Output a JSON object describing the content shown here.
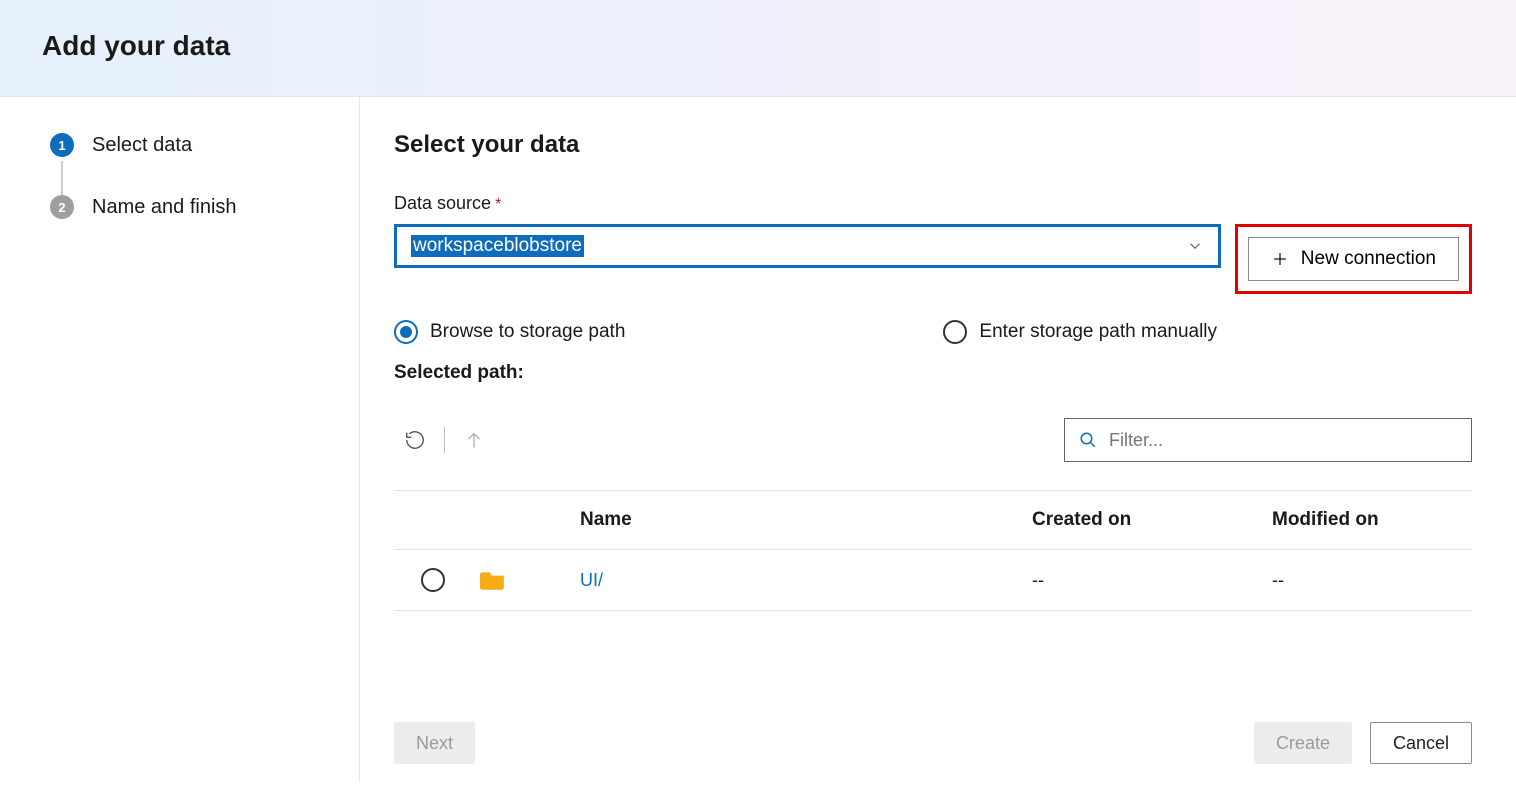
{
  "header": {
    "title": "Add your data"
  },
  "steps": [
    {
      "num": "1",
      "label": "Select data",
      "active": true
    },
    {
      "num": "2",
      "label": "Name and finish",
      "active": false
    }
  ],
  "panel": {
    "heading": "Select your data",
    "data_source_label": "Data source",
    "data_source_value": "workspaceblobstore",
    "new_connection_label": "New connection",
    "radio_browse": "Browse to storage path",
    "radio_manual": "Enter storage path manually",
    "selected_path_label": "Selected path:",
    "filter_placeholder": "Filter..."
  },
  "table": {
    "columns": {
      "name": "Name",
      "created": "Created on",
      "modified": "Modified on"
    },
    "rows": [
      {
        "name": "UI/",
        "created": "--",
        "modified": "--"
      }
    ]
  },
  "footer": {
    "next": "Next",
    "create": "Create",
    "cancel": "Cancel"
  }
}
